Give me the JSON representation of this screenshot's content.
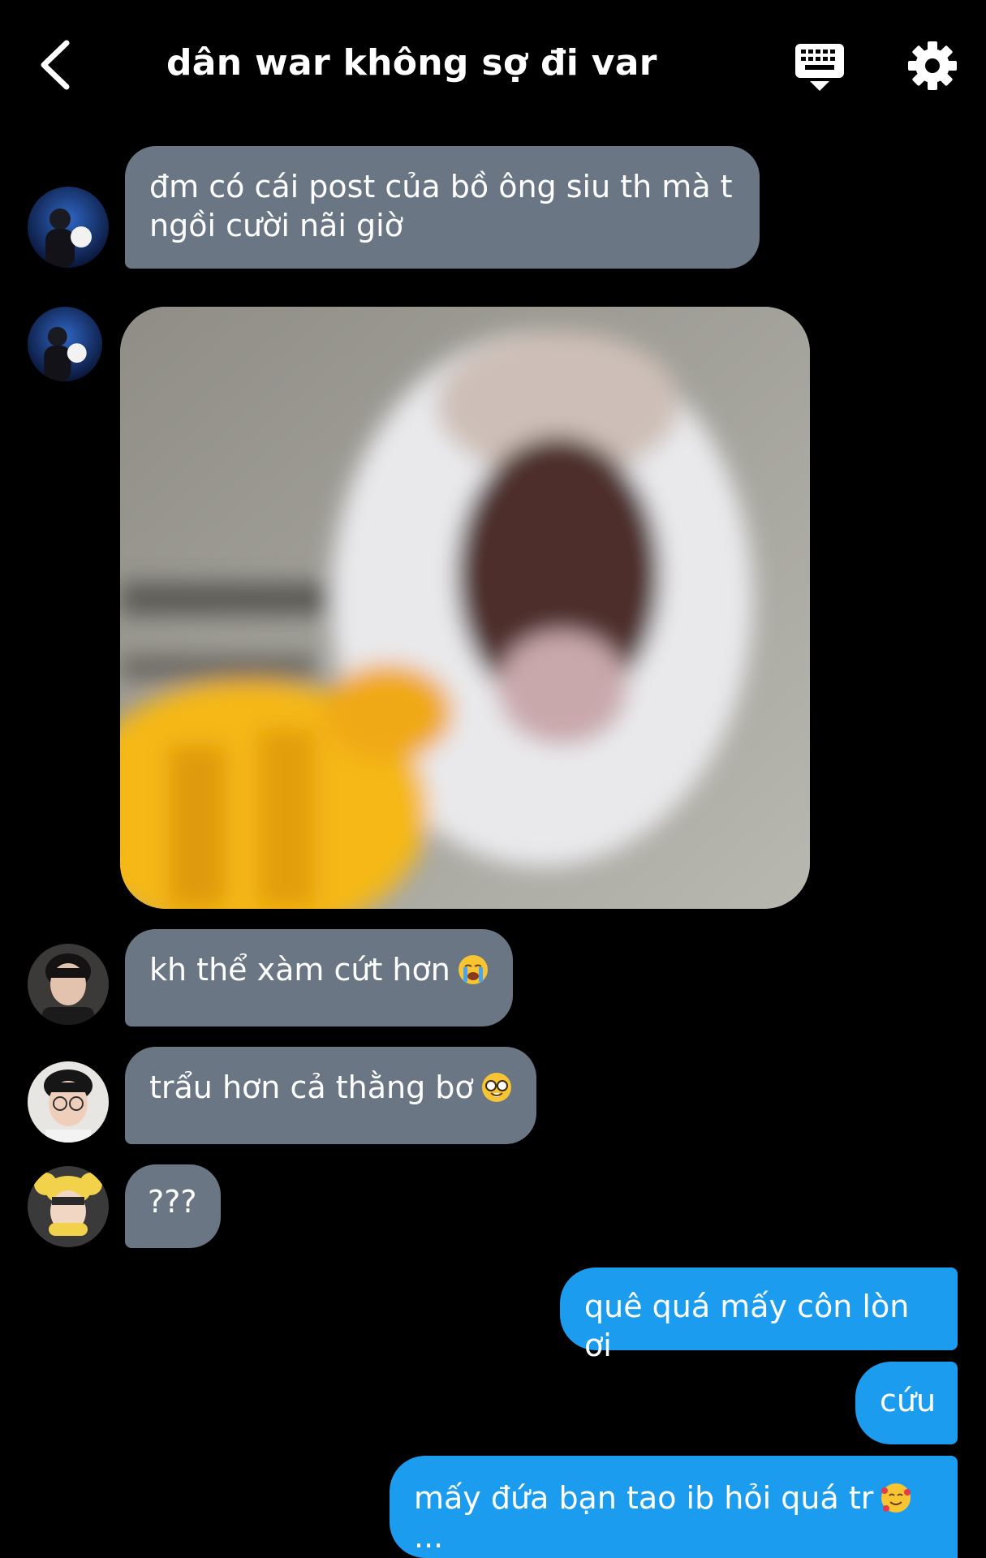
{
  "header": {
    "title": "dân war không sợ đi var"
  },
  "messages": {
    "m1": "đm có cái post của bồ ông siu th mà t ngồi cười nãi giờ",
    "m3": "kh thể xàm cứt hơn",
    "m4": "trẩu hơn cả thằng bơ",
    "m5": "???",
    "o1": "quê quá mấy côn lòn ơi",
    "o2": "cứu",
    "o3": "mấy đứa bạn tao ib hỏi quá tr",
    "o3_ellipsis": "..."
  },
  "icons": {
    "back": "chevron-left-icon",
    "keyboard": "keyboard-icon",
    "settings": "gear-icon"
  },
  "colors": {
    "incoming_bubble": "#6a7684",
    "outgoing_bubble": "#1c9cee",
    "background": "#000000"
  }
}
